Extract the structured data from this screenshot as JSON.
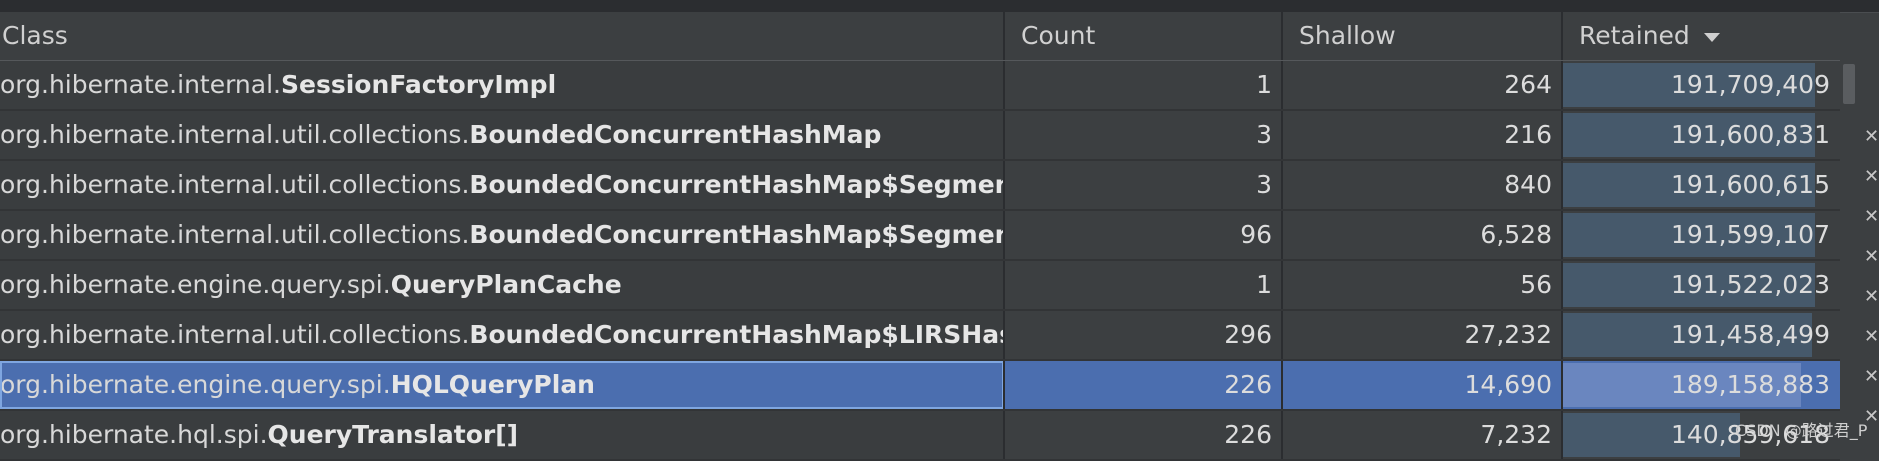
{
  "header": {
    "class_label": "Class",
    "count_label": "Count",
    "shallow_label": "Shallow",
    "retained_label": "Retained"
  },
  "rows": [
    {
      "pkg": "org.hibernate.internal.",
      "name": "SessionFactoryImpl",
      "count": "1",
      "shallow": "264",
      "retained": "191,709,409",
      "ret_frac": 0.91
    },
    {
      "pkg": "org.hibernate.internal.util.collections.",
      "name": "BoundedConcurrentHashMap",
      "count": "3",
      "shallow": "216",
      "retained": "191,600,831",
      "ret_frac": 0.91
    },
    {
      "pkg": "org.hibernate.internal.util.collections.",
      "name": "BoundedConcurrentHashMap$Segment[]",
      "count": "3",
      "shallow": "840",
      "retained": "191,600,615",
      "ret_frac": 0.91
    },
    {
      "pkg": "org.hibernate.internal.util.collections.",
      "name": "BoundedConcurrentHashMap$Segment",
      "count": "96",
      "shallow": "6,528",
      "retained": "191,599,107",
      "ret_frac": 0.91
    },
    {
      "pkg": "org.hibernate.engine.query.spi.",
      "name": "QueryPlanCache",
      "count": "1",
      "shallow": "56",
      "retained": "191,522,023",
      "ret_frac": 0.91
    },
    {
      "pkg": "org.hibernate.internal.util.collections.",
      "name": "BoundedConcurrentHashMap$LIRSHashEntry",
      "count": "296",
      "shallow": "27,232",
      "retained": "191,458,499",
      "ret_frac": 0.9
    },
    {
      "pkg": "org.hibernate.engine.query.spi.",
      "name": "HQLQueryPlan",
      "count": "226",
      "shallow": "14,690",
      "retained": "189,158,883",
      "ret_frac": 0.86,
      "selected": true
    },
    {
      "pkg": "org.hibernate.hql.spi.",
      "name": "QueryTranslator[]",
      "count": "226",
      "shallow": "7,232",
      "retained": "140,859,618",
      "ret_frac": 0.64
    }
  ],
  "watermark": "CSDN @路过君_P"
}
